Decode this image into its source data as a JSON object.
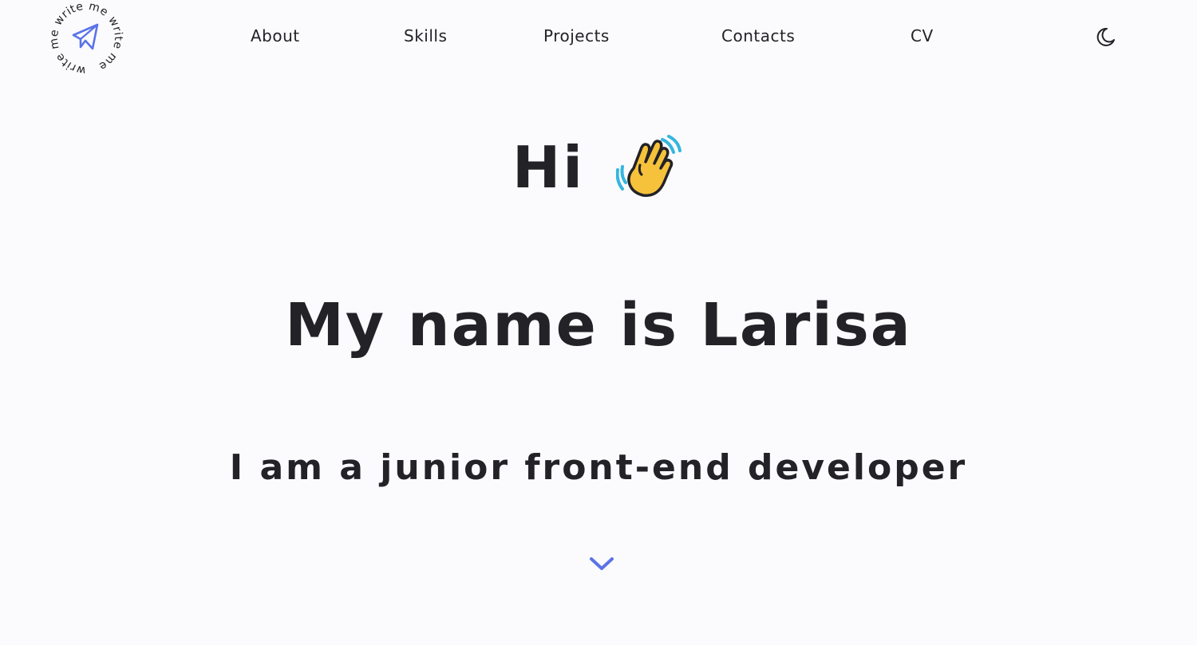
{
  "header": {
    "logo": {
      "circle_text": "write me write me write me",
      "icon": "paper-plane-icon",
      "accent_color": "#5b73e8"
    },
    "nav": [
      {
        "label": "About"
      },
      {
        "label": "Skills"
      },
      {
        "label": "Projects"
      },
      {
        "label": "Contacts"
      },
      {
        "label": "CV"
      }
    ],
    "theme_toggle": {
      "icon": "moon-icon"
    }
  },
  "hero": {
    "greeting": "Hi",
    "greeting_icon": "waving-hand-icon",
    "name_line": "My name is Larisa",
    "role_line": "I am a junior front-end developer",
    "scroll_icon": "chevron-down-icon"
  },
  "colors": {
    "background": "#fbfbfd",
    "text": "#222227",
    "accent": "#5b73e8",
    "wave_yellow": "#f6c23b",
    "wave_motion": "#35b6de"
  }
}
